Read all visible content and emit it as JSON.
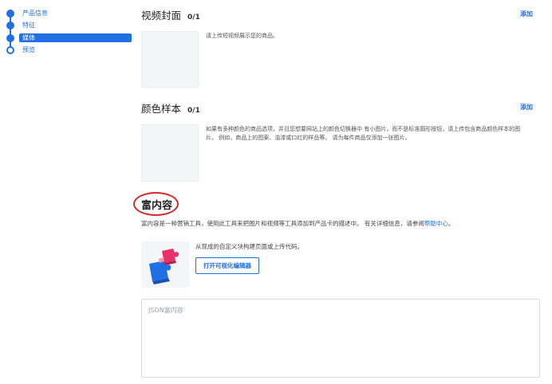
{
  "stepnav": {
    "items": [
      {
        "label": "产品信息"
      },
      {
        "label": "特征"
      },
      {
        "label": "媒体"
      },
      {
        "label": "预览"
      }
    ]
  },
  "video_cover": {
    "title": "视频封面",
    "count": "0/1",
    "add_label": "添加",
    "hint": "请上传短视频展示您的商品。"
  },
  "color_swatch": {
    "title": "颜色样本",
    "count": "0/1",
    "add_label": "添加",
    "hint_line1": "如果有多种颜色的商品选项，并且您想要网站上的颜色切换器中 有小图片，而不是标准圆形按钮，请上传包含商品颜色样本的图",
    "hint_line2": "片。 例如，商品上的图案、油漆或口红的样品等。 请为每件商品仅添加一张图片。"
  },
  "rich_content": {
    "title": "富内容",
    "desc": "富内容是一种营销工具，使用此工具来把图片和视频等工具添加到产品卡的描述中。 有关详细信息，请参阅",
    "help_link": "帮助中心",
    "desc_end": "。",
    "builder_text": "从现成的自定义块构建页面或上传代码。",
    "open_editor_label": "打开可视化编辑器",
    "json_placeholder": "JSON富内容"
  },
  "colors": {
    "accent": "#1f6fe5",
    "highlight_circle": "#d9262b"
  }
}
